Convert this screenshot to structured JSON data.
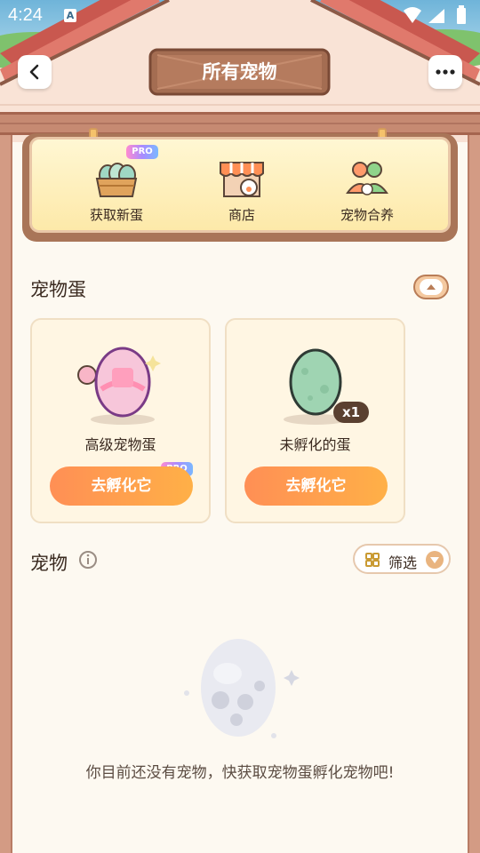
{
  "status_bar": {
    "time": "4:24",
    "notification_letter": "A"
  },
  "header": {
    "title": "所有宠物",
    "back_icon": "chevron-left-icon",
    "more_icon": "more-dots-icon"
  },
  "menu": {
    "items": [
      {
        "label": "获取新蛋",
        "icon": "egg-basket-icon",
        "badge": "PRO"
      },
      {
        "label": "商店",
        "icon": "shop-icon"
      },
      {
        "label": "宠物合养",
        "icon": "pet-group-icon"
      }
    ]
  },
  "eggs_section": {
    "title": "宠物蛋",
    "cards": [
      {
        "name": "高级宠物蛋",
        "button": "去孵化它",
        "badge": "PRO",
        "icon": "premium-egg-icon"
      },
      {
        "name": "未孵化的蛋",
        "button": "去孵化它",
        "count": "x1",
        "icon": "green-egg-icon"
      }
    ]
  },
  "pets_section": {
    "title": "宠物",
    "filter_label": "筛选",
    "empty_message": "你目前还没有宠物，快获取宠物蛋孵化宠物吧!"
  },
  "colors": {
    "accent_orange": "#ff9a4f",
    "brown": "#a97558",
    "pro_gradient": "#a98bff"
  }
}
